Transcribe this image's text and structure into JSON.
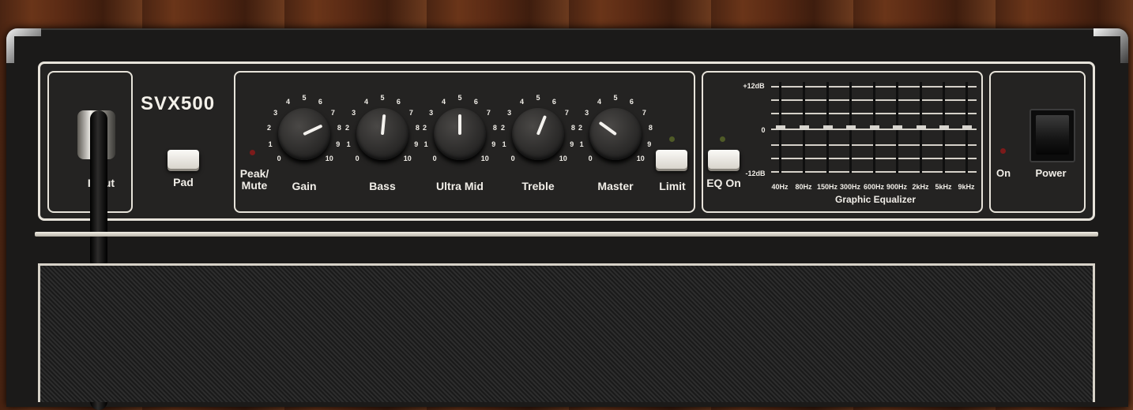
{
  "model": "SVX500",
  "input_label": "Input",
  "pad_label": "Pad",
  "peak_mute_label": "Peak/\nMute",
  "knobs": [
    {
      "label": "Gain",
      "value": 7.4
    },
    {
      "label": "Bass",
      "value": 5.2
    },
    {
      "label": "Ultra Mid",
      "value": 5.0
    },
    {
      "label": "Treble",
      "value": 5.8
    },
    {
      "label": "Master",
      "value": 3.0
    }
  ],
  "knob_scale": [
    "0",
    "1",
    "2",
    "3",
    "4",
    "5",
    "6",
    "7",
    "8",
    "9",
    "10"
  ],
  "limit_label": "Limit",
  "eq": {
    "on_label": "EQ On",
    "scale": [
      "+12dB",
      "0",
      "-12dB"
    ],
    "bands": [
      "40Hz",
      "80Hz",
      "150Hz",
      "300Hz",
      "600Hz",
      "900Hz",
      "2kHz",
      "5kHz",
      "9kHz"
    ],
    "values_db": [
      0,
      0,
      0,
      0,
      0,
      0,
      0,
      0,
      0
    ],
    "title": "Graphic Equalizer"
  },
  "on_label": "On",
  "power_label": "Power",
  "colors": {
    "panel_line": "#e7e3da",
    "led_red": "#9b1f1f",
    "led_green": "#4f5a27"
  }
}
